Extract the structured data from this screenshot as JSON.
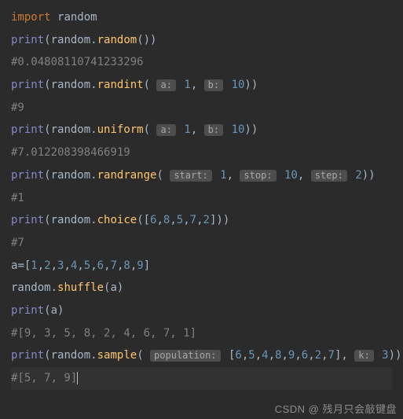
{
  "code": {
    "l1": {
      "kw": "import",
      "mod": "random"
    },
    "l2": {
      "fn": "print",
      "obj": "random",
      "method": "random"
    },
    "l3": "#0.04808110741233296",
    "l4": {
      "fn": "print",
      "obj": "random",
      "method": "randint",
      "h1": "a:",
      "v1": "1",
      "h2": "b:",
      "v2": "10"
    },
    "l5": "#9",
    "l6": {
      "fn": "print",
      "obj": "random",
      "method": "uniform",
      "h1": "a:",
      "v1": "1",
      "h2": "b:",
      "v2": "10"
    },
    "l7": "#7.012208398466919",
    "l8": {
      "fn": "print",
      "obj": "random",
      "method": "randrange",
      "h1": "start:",
      "v1": "1",
      "h2": "stop:",
      "v2": "10",
      "h3": "step:",
      "v3": "2"
    },
    "l9": "#1",
    "l10": {
      "fn": "print",
      "obj": "random",
      "method": "choice",
      "list": "6,8,5,7,2"
    },
    "l11": "#7",
    "l12": {
      "var": "a",
      "list": "1,2,3,4,5,6,7,8,9"
    },
    "l13": {
      "obj": "random",
      "method": "shuffle",
      "arg": "a"
    },
    "l14": {
      "fn": "print",
      "arg": "a"
    },
    "l15": "#[9, 3, 5, 8, 2, 4, 6, 7, 1]",
    "l16": {
      "fn": "print",
      "obj": "random",
      "method": "sample",
      "h1": "population:",
      "list": "6,5,4,8,9,6,2,7",
      "h2": "k:",
      "v2": "3"
    },
    "l17": "#[5, 7, 9]"
  },
  "watermark": "CSDN @ 残月只会敲键盘"
}
